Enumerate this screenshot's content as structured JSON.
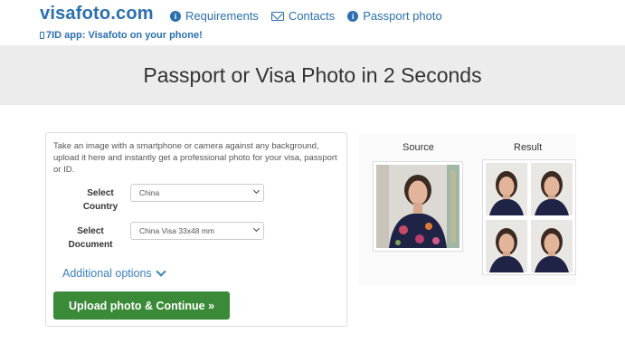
{
  "header": {
    "logo": "visafoto.com",
    "nav": [
      {
        "label": "Requirements",
        "icon": "info-icon"
      },
      {
        "label": "Contacts",
        "icon": "mail-icon"
      },
      {
        "label": "Passport photo",
        "icon": "info-icon"
      }
    ],
    "app_banner": "7ID app: Visafoto on your phone!"
  },
  "hero": {
    "title": "Passport or Visa Photo in 2 Seconds"
  },
  "form": {
    "intro": "Take an image with a smartphone or camera against any background, upload it here and instantly get a professional photo for your visa, passport or ID.",
    "country_label": "Select Country",
    "country_value": "China",
    "document_label": "Select Document",
    "document_value": "China Visa 33x48 mm",
    "additional_options": "Additional options",
    "upload_button": "Upload photo & Continue »"
  },
  "preview": {
    "source_label": "Source",
    "result_label": "Result"
  },
  "colors": {
    "brand": "#2a6fb0",
    "link": "#3a7fbf",
    "upload_button": "#3a8a38",
    "hero_bg": "#ececec"
  }
}
